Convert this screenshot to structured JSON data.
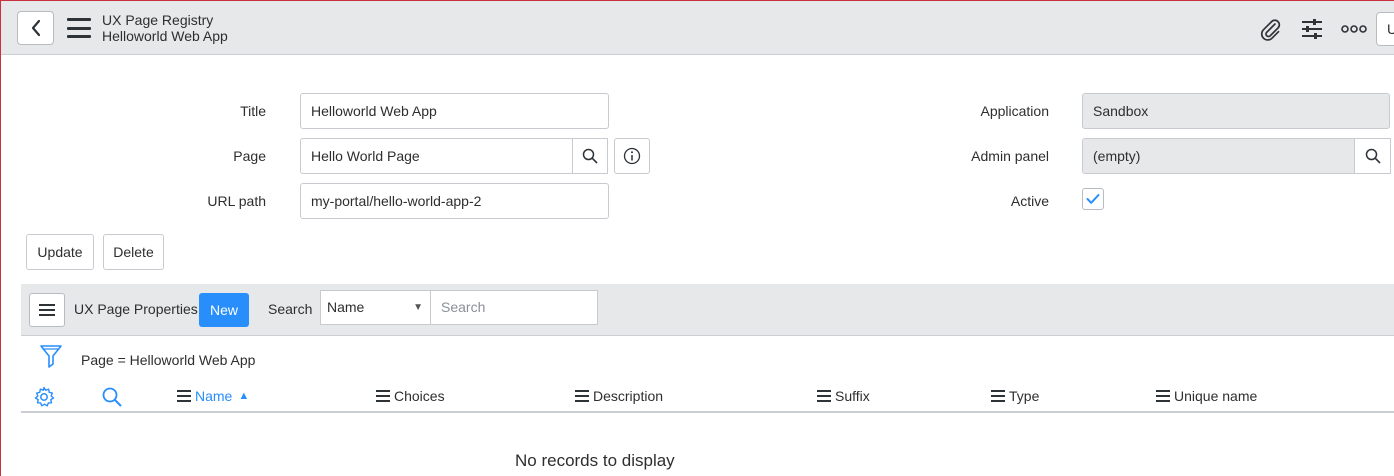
{
  "header": {
    "title": "UX Page Registry",
    "subtitle": "Helloworld Web App",
    "back_icon": "chevron-left-icon",
    "right_icons": [
      "paperclip-icon",
      "sliders-icon",
      "more-icon"
    ],
    "cut_button_label": "U"
  },
  "form": {
    "title_label": "Title",
    "title_value": "Helloworld Web App",
    "page_label": "Page",
    "page_value": "Hello World Page",
    "url_label": "URL path",
    "url_value": "my-portal/hello-world-app-2",
    "application_label": "Application",
    "application_value": "Sandbox",
    "admin_label": "Admin panel",
    "admin_value": "(empty)",
    "active_label": "Active",
    "active_checked": true
  },
  "actions": {
    "update": "Update",
    "delete": "Delete"
  },
  "related_list": {
    "title": "UX Page Properties",
    "new_label": "New",
    "search_label": "Search",
    "search_field": "Name",
    "search_placeholder": "Search",
    "filter_breadcrumb": "Page = Helloworld Web App",
    "columns": [
      "Name",
      "Choices",
      "Description",
      "Suffix",
      "Type",
      "Unique name"
    ],
    "sorted_column": "Name",
    "sort_direction": "ascending",
    "empty_message": "No records to display"
  },
  "colors": {
    "accent": "#278efc",
    "header_bg": "#e6e8ea"
  }
}
